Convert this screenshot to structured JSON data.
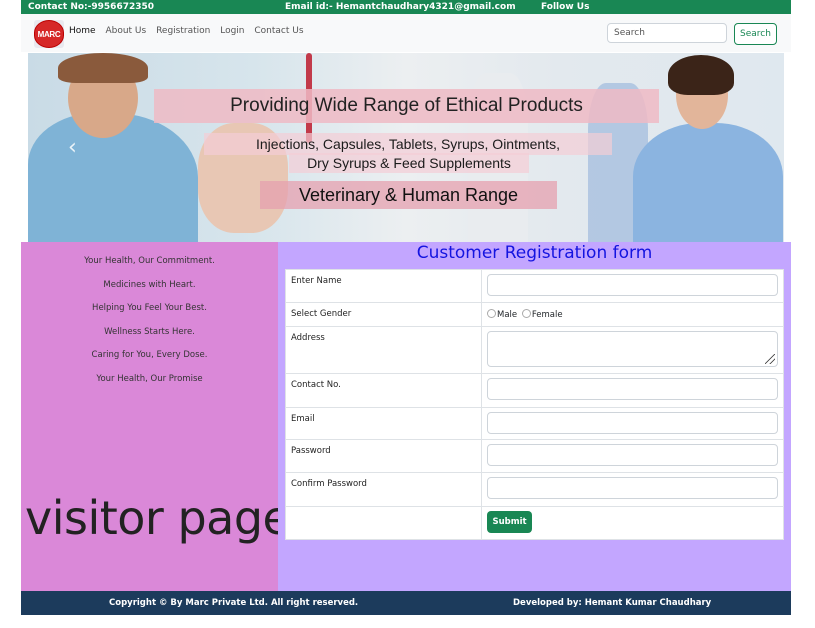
{
  "topbar": {
    "contact": "Contact No:-9956672350",
    "email": "Email id:- Hemantchaudhary4321@gmail.com",
    "follow": "Follow Us"
  },
  "navbar": {
    "logo_text": "MARC",
    "links": [
      "Home",
      "About Us",
      "Registration",
      "Login",
      "Contact Us"
    ],
    "search_placeholder": "Search",
    "search_button": "Search"
  },
  "banner": {
    "title": "Providing Wide Range of Ethical Products",
    "line1": "Injections,  Capsules,  Tablets,  Syrups,  Ointments,",
    "line2": "Dry  Syrups  &  Feed  Supplements",
    "range": "Veterinary & Human Range",
    "prev_icon": "‹"
  },
  "sidebar": {
    "slogans": [
      "Your Health, Our Commitment.",
      "Medicines with Heart.",
      "Helping You Feel Your Best.",
      "Wellness Starts Here.",
      "Caring for You, Every Dose.",
      "Your Health, Our Promise"
    ],
    "visitor_text": "visitor page"
  },
  "form": {
    "title": "Customer Registration form",
    "labels": {
      "name": "Enter Name",
      "gender": "Select Gender",
      "address": "Address",
      "contact": "Contact No.",
      "email": "Email",
      "password": "Password",
      "confirm": "Confirm Password"
    },
    "gender_options": [
      "Male",
      "Female"
    ],
    "submit": "Submit"
  },
  "footer": {
    "copyright": "Copyright © By Marc Private Ltd. All right reserved.",
    "developer": "Developed by: Hemant Kumar Chaudhary"
  },
  "colors": {
    "topbar": "#198754",
    "sidebar": "#da88d8",
    "main": "#c3a6ff",
    "footer": "#1c3b5c",
    "form_title": "#1414e0"
  }
}
